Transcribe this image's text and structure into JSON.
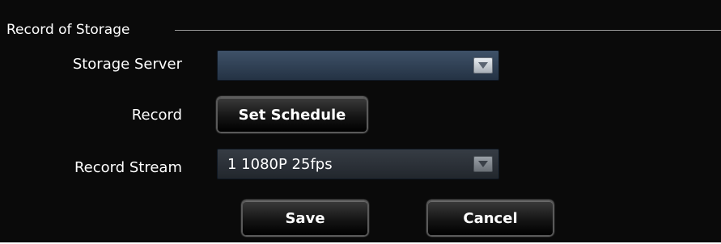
{
  "group": {
    "title": "Record of Storage"
  },
  "storage_server": {
    "label": "Storage Server",
    "value": ""
  },
  "record": {
    "label": "Record",
    "button_label": "Set Schedule"
  },
  "record_stream": {
    "label": "Record Stream",
    "value": "1 1080P 25fps"
  },
  "actions": {
    "save_label": "Save",
    "cancel_label": "Cancel"
  },
  "icons": {
    "dropdown_arrow": "chevron-down-icon"
  }
}
